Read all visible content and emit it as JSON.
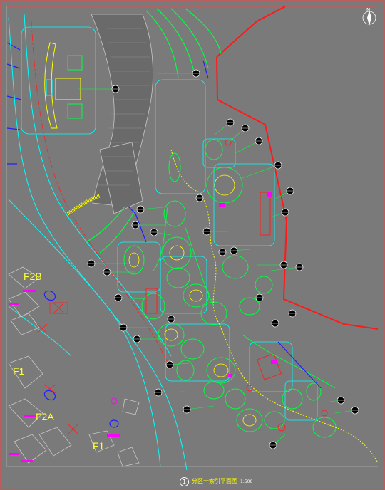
{
  "title": {
    "number": "1",
    "name": "分区一索引平面图",
    "scale": "1:500"
  },
  "north": "N",
  "zones": [
    {
      "id": "f2b",
      "label": "F2B"
    },
    {
      "id": "f1a",
      "label": "F1"
    },
    {
      "id": "f2a",
      "label": "F2A"
    },
    {
      "id": "f1b",
      "label": "F1"
    }
  ],
  "colors": {
    "background": "#7a7a7a",
    "boundary": "#ff1a1a",
    "road": "#00ffff",
    "plan": "#00ff40",
    "building": "#c8c8c8",
    "annotation": "#ffff00"
  }
}
